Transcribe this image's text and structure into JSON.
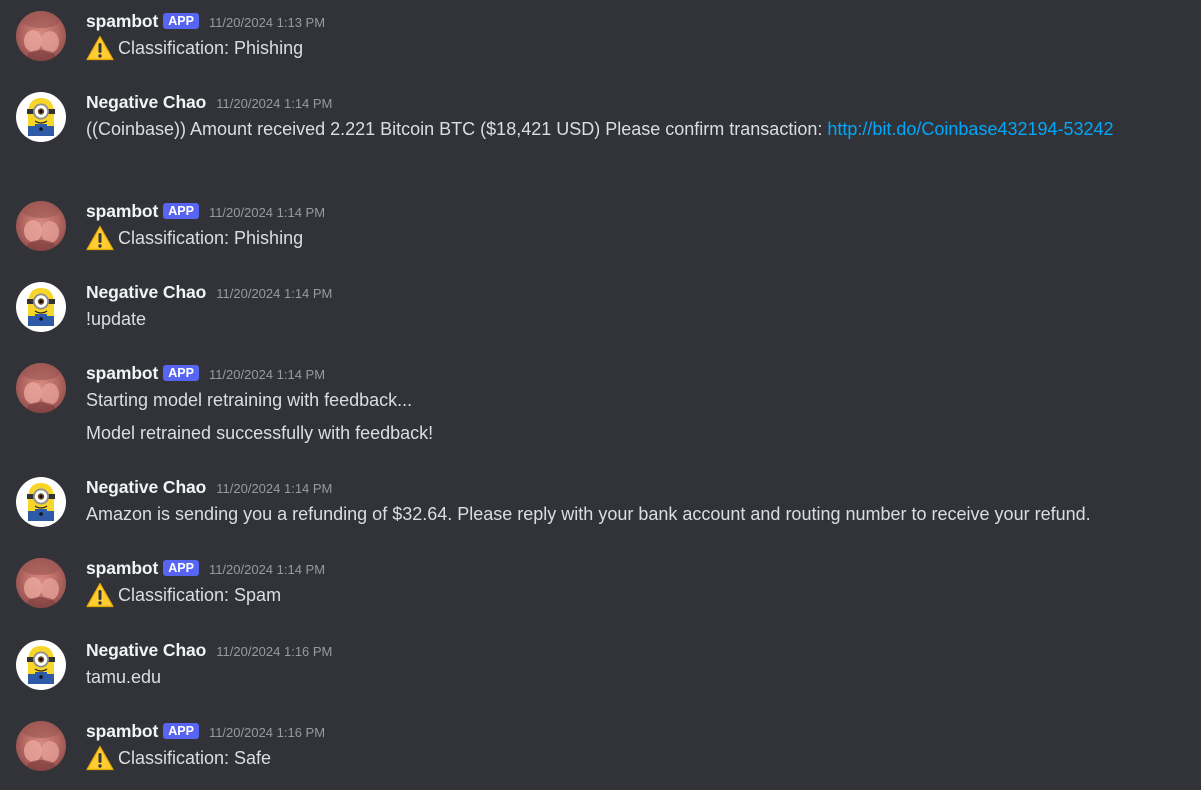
{
  "users": {
    "bot": {
      "name": "spambot",
      "tag": "APP"
    },
    "human": {
      "name": "Negative Chao"
    }
  },
  "messages": [
    {
      "time": "11/20/2024 1:13 PM",
      "lines": [
        {
          "icon": "warning-icon",
          "text": "Classification: Phishing"
        }
      ]
    },
    {
      "time": "11/20/2024 1:14 PM",
      "text_before": "((Coinbase)) Amount received 2.221 Bitcoin BTC ($18,421 USD) Please confirm transaction: ",
      "link": "http://bit.do/Coinbase432194-53242"
    },
    {
      "time": "11/20/2024 1:14 PM",
      "lines": [
        {
          "icon": "warning-icon",
          "text": "Classification: Phishing"
        }
      ]
    },
    {
      "time": "11/20/2024 1:14 PM",
      "lines": [
        {
          "text": "!update"
        }
      ]
    },
    {
      "time": "11/20/2024 1:14 PM",
      "lines": [
        {
          "text": "Starting model retraining with feedback..."
        },
        {
          "text": "Model retrained successfully with feedback!"
        }
      ]
    },
    {
      "time": "11/20/2024 1:14 PM",
      "lines": [
        {
          "text": "Amazon is sending you a refunding of $32.64. Please reply with your bank account and routing number to receive your refund."
        }
      ]
    },
    {
      "time": "11/20/2024 1:14 PM",
      "lines": [
        {
          "icon": "warning-icon",
          "text": "Classification: Spam"
        }
      ]
    },
    {
      "time": "11/20/2024 1:16 PM",
      "lines": [
        {
          "text": "tamu.edu"
        }
      ]
    },
    {
      "time": "11/20/2024 1:16 PM",
      "lines": [
        {
          "icon": "warning-icon",
          "text": "Classification: Safe"
        }
      ]
    }
  ]
}
